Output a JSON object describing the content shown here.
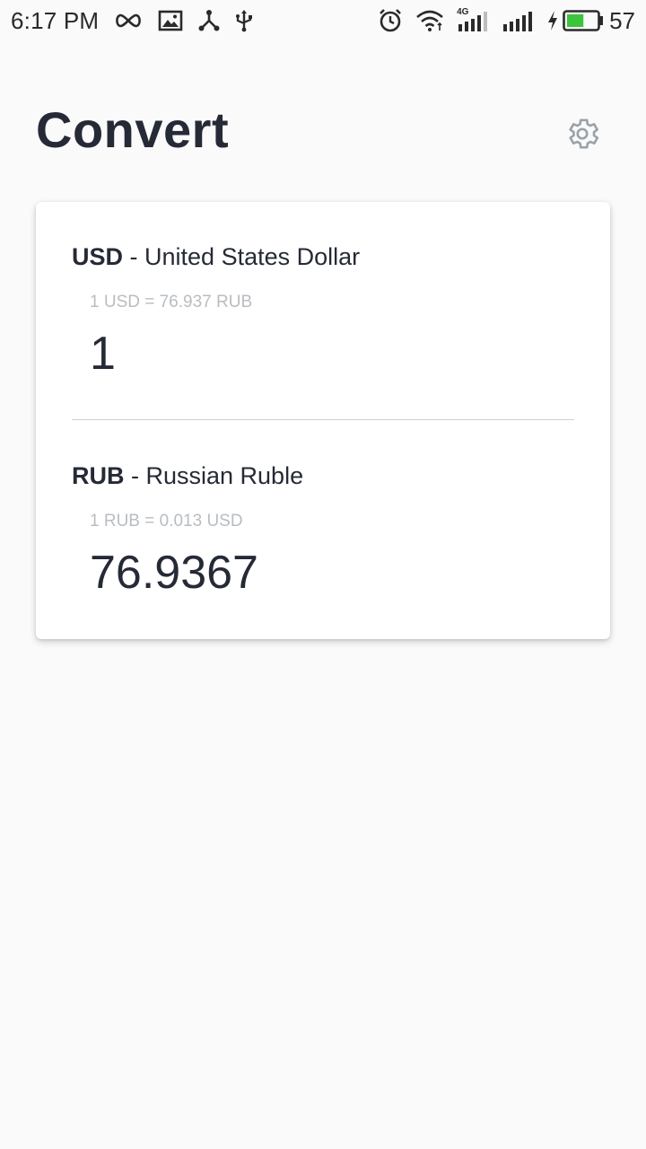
{
  "status_bar": {
    "time": "6:17 PM",
    "battery_percent": "57",
    "network_label": "4G",
    "left_icons": [
      "infinity-icon",
      "image-icon",
      "share-icon",
      "usb-icon"
    ],
    "right_icons": [
      "alarm-icon",
      "wifi-icon",
      "signal-4g-icon",
      "signal-icon",
      "charging-icon",
      "battery-icon"
    ],
    "battery_level": 0.57,
    "battery_color": "#3cc43c"
  },
  "header": {
    "title": "Convert",
    "settings_icon": "gear-icon"
  },
  "converter": {
    "from": {
      "code": "USD",
      "separator": " - ",
      "name": "United States Dollar",
      "rate": "1 USD = 76.937 RUB",
      "amount": "1"
    },
    "to": {
      "code": "RUB",
      "separator": " - ",
      "name": "Russian Ruble",
      "rate": "1 RUB = 0.013 USD",
      "amount": "76.9367"
    }
  },
  "colors": {
    "background": "#fafafa",
    "card": "#ffffff",
    "text_primary": "#252a36",
    "text_muted": "#b9bdc1",
    "icon_muted": "#9aa3aa"
  }
}
